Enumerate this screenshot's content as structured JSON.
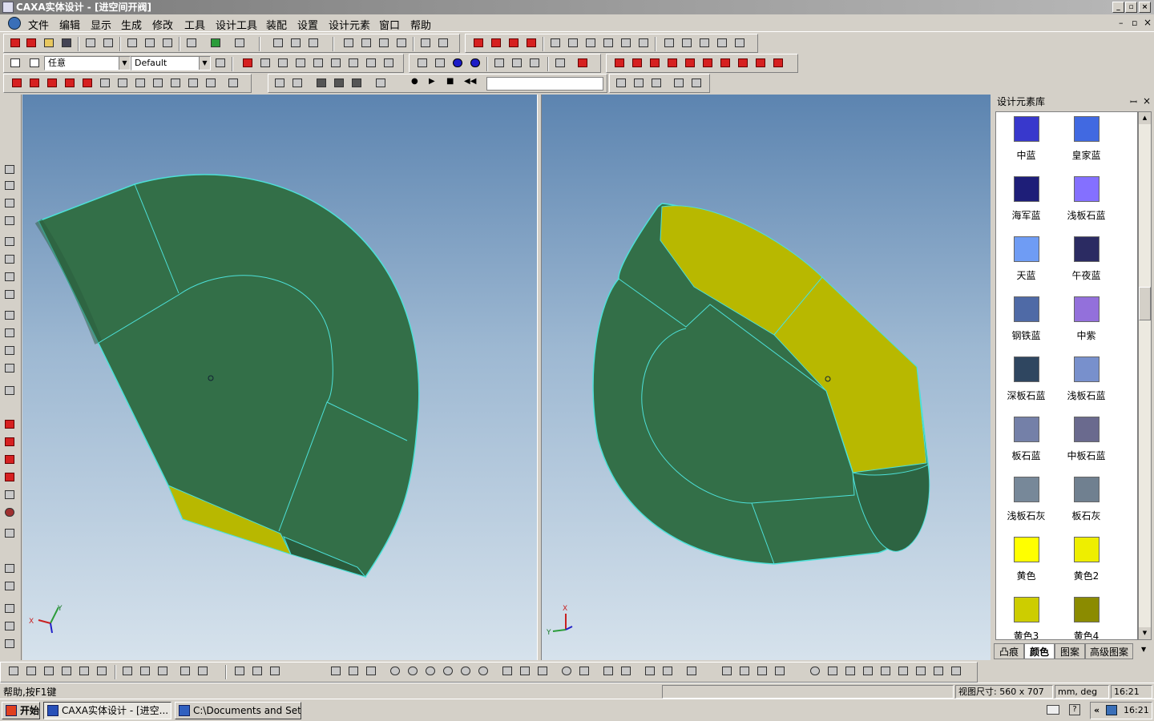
{
  "window": {
    "title": "CAXA实体设计 - [进空间开阀]"
  },
  "menu": [
    "文件",
    "编辑",
    "显示",
    "生成",
    "修改",
    "工具",
    "设计工具",
    "装配",
    "设置",
    "设计元素",
    "窗口",
    "帮助"
  ],
  "toolbar": {
    "filter_value": "任意",
    "style_value": "Default"
  },
  "viewports": {
    "left_axes": {
      "x": "X",
      "y": "Y"
    },
    "right_axes": {
      "x": "X",
      "y": "Y"
    }
  },
  "panel": {
    "title": "设计元素库",
    "swatches": [
      {
        "label": "中蓝",
        "color": "#3838cc"
      },
      {
        "label": "皇家蓝",
        "color": "#4169e1"
      },
      {
        "label": "海军蓝",
        "color": "#1e1e78"
      },
      {
        "label": "浅板石蓝",
        "color": "#8470ff"
      },
      {
        "label": "天蓝",
        "color": "#6f9cf4"
      },
      {
        "label": "午夜蓝",
        "color": "#2b2b62"
      },
      {
        "label": "钢铁蓝",
        "color": "#4f6aa6"
      },
      {
        "label": "中紫",
        "color": "#9370db"
      },
      {
        "label": "深板石蓝",
        "color": "#2f4660"
      },
      {
        "label": "浅板石蓝",
        "color": "#7890cc"
      },
      {
        "label": "板石蓝",
        "color": "#7480a8"
      },
      {
        "label": "中板石蓝",
        "color": "#6a6a8e"
      },
      {
        "label": "浅板石灰",
        "color": "#778899"
      },
      {
        "label": "板石灰",
        "color": "#708090"
      },
      {
        "label": "黄色",
        "color": "#ffff00"
      },
      {
        "label": "黄色2",
        "color": "#eeee00"
      },
      {
        "label": "黄色3",
        "color": "#cdcd00"
      },
      {
        "label": "黄色4",
        "color": "#8b8b00"
      }
    ],
    "tabs": [
      "凸痕",
      "颜色",
      "图案",
      "高级图案"
    ],
    "active_tab": "颜色"
  },
  "status": {
    "help": "帮助,按F1键",
    "view_size_label": "视图尺寸:",
    "view_size": "560 x 707",
    "units": "mm, deg",
    "time_field": "16:21"
  },
  "taskbar": {
    "start": "开始",
    "tasks": [
      "CAXA实体设计 - [进空...",
      "C:\\Documents and Settin..."
    ],
    "clock": "16:21"
  },
  "colors": {
    "part_green": "#336f48",
    "edge_cyan": "#4de0d8",
    "face_yellow": "#c8c000"
  }
}
